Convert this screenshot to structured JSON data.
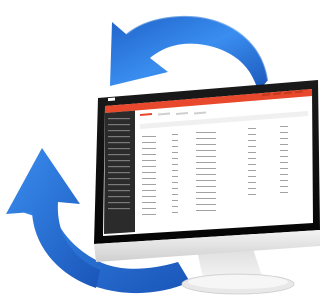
{
  "app": {
    "brand_color": "#e8492c",
    "sidebar_color": "#2b2b2b",
    "arrow_color": "#2a7be4",
    "sidebar_item_count": 16,
    "table_row_count": 18
  },
  "icons": {
    "top_arrow": "refresh-arrow-icon",
    "bottom_arrow": "refresh-arrow-icon"
  }
}
